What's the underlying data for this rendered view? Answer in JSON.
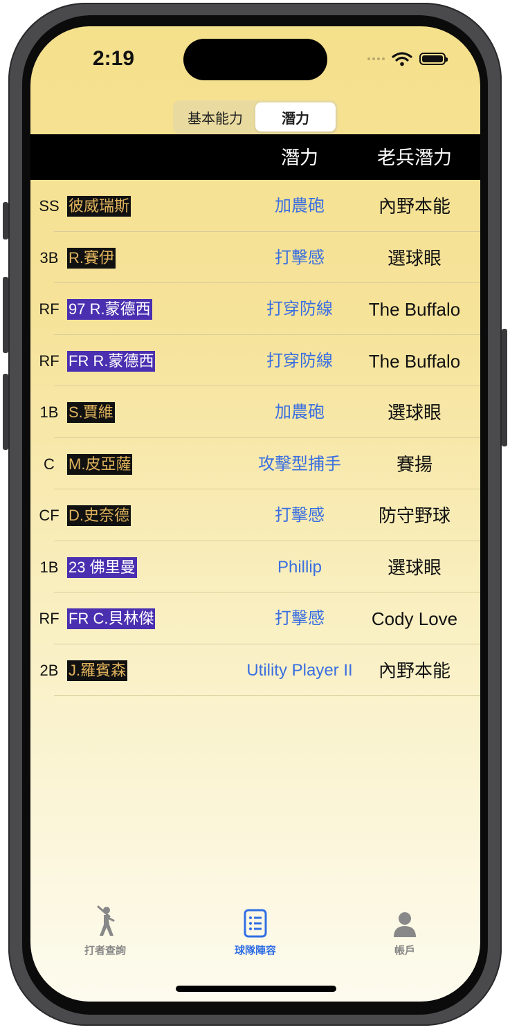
{
  "status": {
    "time": "2:19"
  },
  "segmented": {
    "options": [
      "基本能力",
      "潛力"
    ],
    "selected": 1
  },
  "header": {
    "col_potential": "潛力",
    "col_veteran": "老兵潛力"
  },
  "rows": [
    {
      "pos": "SS",
      "name": "彼威瑞斯",
      "style": "gold",
      "potential": "加農砲",
      "veteran": "內野本能"
    },
    {
      "pos": "3B",
      "name": "R.賽伊",
      "style": "gold",
      "potential": "打擊感",
      "veteran": "選球眼"
    },
    {
      "pos": "RF",
      "name": "97 R.蒙德西",
      "style": "purple",
      "potential": "打穿防線",
      "veteran": "The Buffalo"
    },
    {
      "pos": "RF",
      "name": "FR R.蒙德西",
      "style": "purple",
      "potential": "打穿防線",
      "veteran": "The Buffalo"
    },
    {
      "pos": "1B",
      "name": "S.賈維",
      "style": "gold",
      "potential": "加農砲",
      "veteran": "選球眼"
    },
    {
      "pos": "C",
      "name": "M.皮亞薩",
      "style": "gold",
      "potential": "攻擊型捕手",
      "veteran": "賽揚"
    },
    {
      "pos": "CF",
      "name": "D.史奈德",
      "style": "gold",
      "potential": "打擊感",
      "veteran": "防守野球"
    },
    {
      "pos": "1B",
      "name": "23 佛里曼",
      "style": "purple",
      "potential": "Phillip",
      "veteran": "選球眼"
    },
    {
      "pos": "RF",
      "name": "FR C.貝林傑",
      "style": "purple",
      "potential": "打擊感",
      "veteran": "Cody Love"
    },
    {
      "pos": "2B",
      "name": "J.羅賓森",
      "style": "gold",
      "potential": "Utility Player II",
      "veteran": "內野本能"
    }
  ],
  "tabs": [
    {
      "label": "打者查詢",
      "icon": "batter-icon",
      "active": false
    },
    {
      "label": "球隊陣容",
      "icon": "roster-list-icon",
      "active": true
    },
    {
      "label": "帳戶",
      "icon": "person-icon",
      "active": false
    }
  ],
  "colors": {
    "accent": "#2f6fe4",
    "potential_text": "#3a6fe0",
    "gold_name": "#e0b35c",
    "purple_name_bg": "#4a2fb0"
  }
}
